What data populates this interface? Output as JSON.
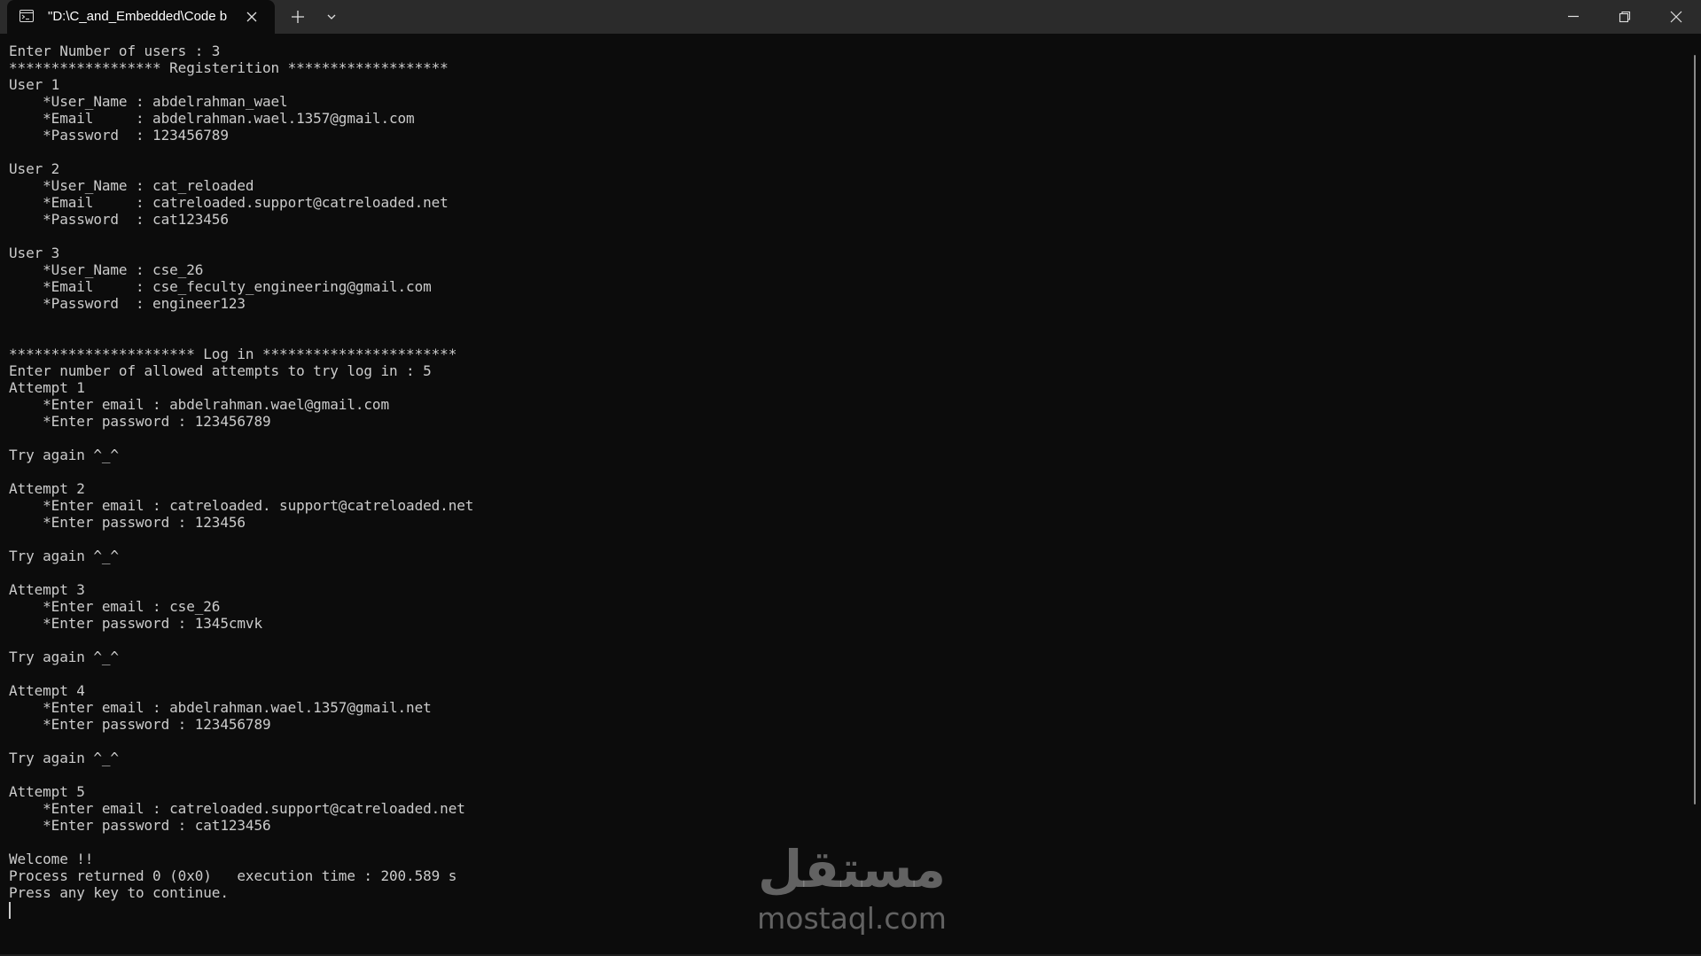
{
  "tab": {
    "title": "\"D:\\C_and_Embedded\\Code b",
    "icon": "console-app-icon"
  },
  "titlebar": {
    "icons": [
      "close-icon",
      "plus-icon",
      "chevron-down-icon",
      "minimize-icon",
      "maximize-icon",
      "window-close-icon"
    ]
  },
  "console": {
    "lines": [
      "Enter Number of users : 3",
      "****************** Registerition *******************",
      "User 1",
      "    *User_Name : abdelrahman_wael",
      "    *Email     : abdelrahman.wael.1357@gmail.com",
      "    *Password  : 123456789",
      "",
      "User 2",
      "    *User_Name : cat_reloaded",
      "    *Email     : catreloaded.support@catreloaded.net",
      "    *Password  : cat123456",
      "",
      "User 3",
      "    *User_Name : cse_26",
      "    *Email     : cse_feculty_engineering@gmail.com",
      "    *Password  : engineer123",
      "",
      "",
      "********************** Log in ***********************",
      "Enter number of allowed attempts to try log in : 5",
      "Attempt 1",
      "    *Enter email : abdelrahman.wael@gmail.com",
      "    *Enter password : 123456789",
      "",
      "Try again ^_^",
      "",
      "Attempt 2",
      "    *Enter email : catreloaded. support@catreloaded.net",
      "    *Enter password : 123456",
      "",
      "Try again ^_^",
      "",
      "Attempt 3",
      "    *Enter email : cse_26",
      "    *Enter password : 1345cmvk",
      "",
      "Try again ^_^",
      "",
      "Attempt 4",
      "    *Enter email : abdelrahman.wael.1357@gmail.net",
      "    *Enter password : 123456789",
      "",
      "Try again ^_^",
      "",
      "Attempt 5",
      "    *Enter email : catreloaded.support@catreloaded.net",
      "    *Enter password : cat123456",
      "",
      "Welcome !!",
      "Process returned 0 (0x0)   execution time : 200.589 s",
      "Press any key to continue."
    ]
  },
  "watermark": {
    "arabic": "مستقل",
    "latin": "mostaql.com"
  },
  "colors": {
    "background": "#0c0c0c",
    "titlebar": "#2b2b2b",
    "text": "#cccccc"
  }
}
